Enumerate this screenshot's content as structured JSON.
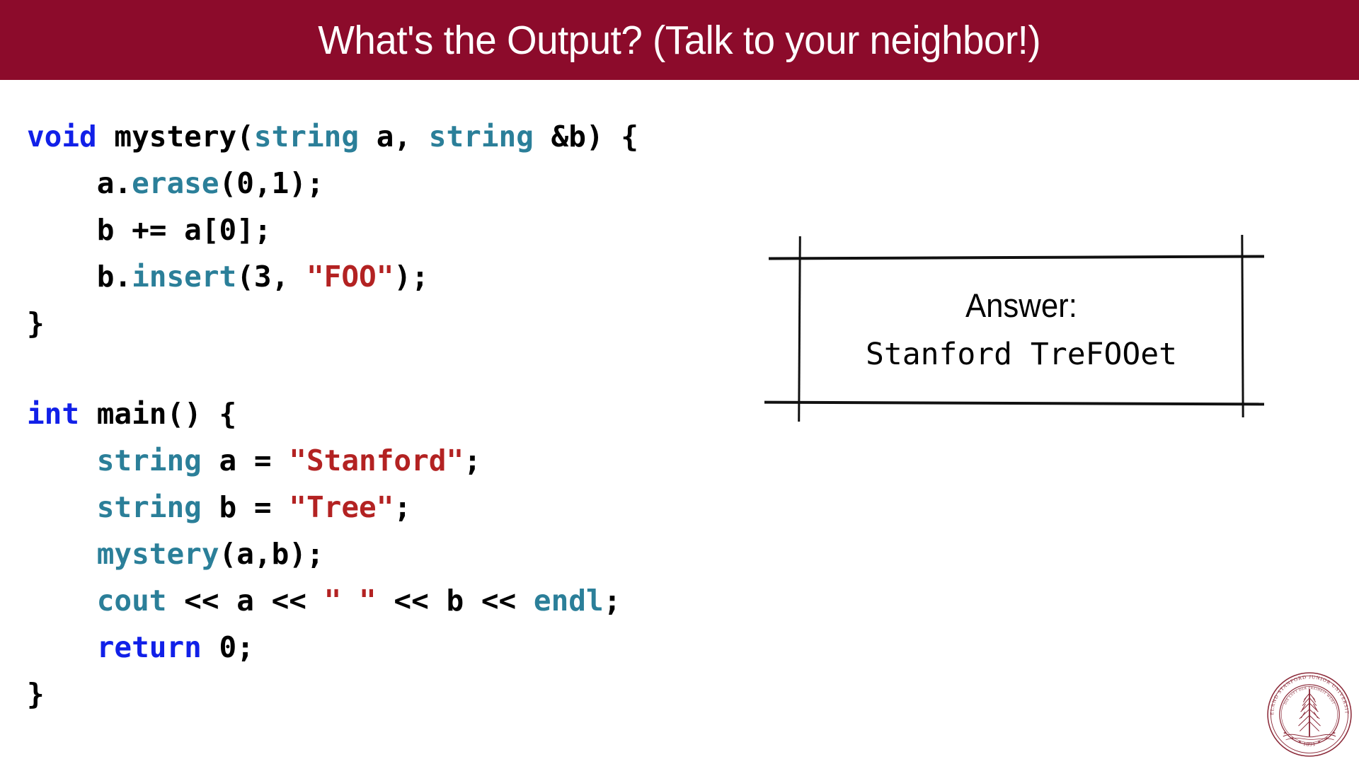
{
  "slide": {
    "title": "What's the Output? (Talk to your neighbor!)",
    "banner_color": "#8C0B2B",
    "background_color": "#FFFFFF"
  },
  "theme": {
    "keyword_color": "#1120E8",
    "type_color": "#2B7F99",
    "string_color": "#B32222",
    "plain_color": "#000000"
  },
  "code": {
    "language": "C++",
    "lines": [
      {
        "id": "line-1",
        "tokens": [
          {
            "t": "void",
            "c": "kw"
          },
          {
            "t": " mystery(",
            "c": "plain"
          },
          {
            "t": "string",
            "c": "type"
          },
          {
            "t": " a, ",
            "c": "plain"
          },
          {
            "t": "string",
            "c": "type"
          },
          {
            "t": " &b) {",
            "c": "plain"
          }
        ]
      },
      {
        "id": "line-2",
        "tokens": [
          {
            "t": "    a.",
            "c": "plain"
          },
          {
            "t": "erase",
            "c": "type"
          },
          {
            "t": "(0,1);",
            "c": "plain"
          }
        ]
      },
      {
        "id": "line-3",
        "tokens": [
          {
            "t": "    b += a[0];",
            "c": "plain"
          }
        ]
      },
      {
        "id": "line-4",
        "tokens": [
          {
            "t": "    b.",
            "c": "plain"
          },
          {
            "t": "insert",
            "c": "type"
          },
          {
            "t": "(3, ",
            "c": "plain"
          },
          {
            "t": "\"FOO\"",
            "c": "str"
          },
          {
            "t": ");",
            "c": "plain"
          }
        ]
      },
      {
        "id": "line-5",
        "tokens": [
          {
            "t": "}",
            "c": "plain"
          }
        ]
      },
      {
        "id": "line-6",
        "tokens": [
          {
            "t": " ",
            "c": "plain"
          }
        ]
      },
      {
        "id": "line-7",
        "tokens": [
          {
            "t": "int",
            "c": "kw"
          },
          {
            "t": " main() {",
            "c": "plain"
          }
        ]
      },
      {
        "id": "line-8",
        "tokens": [
          {
            "t": "    ",
            "c": "plain"
          },
          {
            "t": "string",
            "c": "type"
          },
          {
            "t": " a = ",
            "c": "plain"
          },
          {
            "t": "\"Stanford\"",
            "c": "str"
          },
          {
            "t": ";",
            "c": "plain"
          }
        ]
      },
      {
        "id": "line-9",
        "tokens": [
          {
            "t": "    ",
            "c": "plain"
          },
          {
            "t": "string",
            "c": "type"
          },
          {
            "t": " b = ",
            "c": "plain"
          },
          {
            "t": "\"Tree\"",
            "c": "str"
          },
          {
            "t": ";",
            "c": "plain"
          }
        ]
      },
      {
        "id": "line-10",
        "tokens": [
          {
            "t": "    ",
            "c": "plain"
          },
          {
            "t": "mystery",
            "c": "type"
          },
          {
            "t": "(a,b);",
            "c": "plain"
          }
        ]
      },
      {
        "id": "line-11",
        "tokens": [
          {
            "t": "    ",
            "c": "plain"
          },
          {
            "t": "cout",
            "c": "type"
          },
          {
            "t": " << a << ",
            "c": "plain"
          },
          {
            "t": "\" \"",
            "c": "str"
          },
          {
            "t": " << b << ",
            "c": "plain"
          },
          {
            "t": "endl",
            "c": "type"
          },
          {
            "t": ";",
            "c": "plain"
          }
        ]
      },
      {
        "id": "line-12",
        "tokens": [
          {
            "t": "    ",
            "c": "plain"
          },
          {
            "t": "return",
            "c": "kw"
          },
          {
            "t": " 0;",
            "c": "plain"
          }
        ]
      },
      {
        "id": "line-13",
        "tokens": [
          {
            "t": "}",
            "c": "plain"
          }
        ]
      }
    ]
  },
  "answer_box": {
    "label": "Answer:",
    "value": "Stanford TreFOOet"
  },
  "seal": {
    "name": "stanford-seal",
    "outer_text": "LELAND STANFORD JUNIOR UNIVERSITY",
    "inner_text": "DIE LUFT DER FREIHEIT WEHT",
    "year": "1891",
    "color": "#8C2B3A"
  }
}
